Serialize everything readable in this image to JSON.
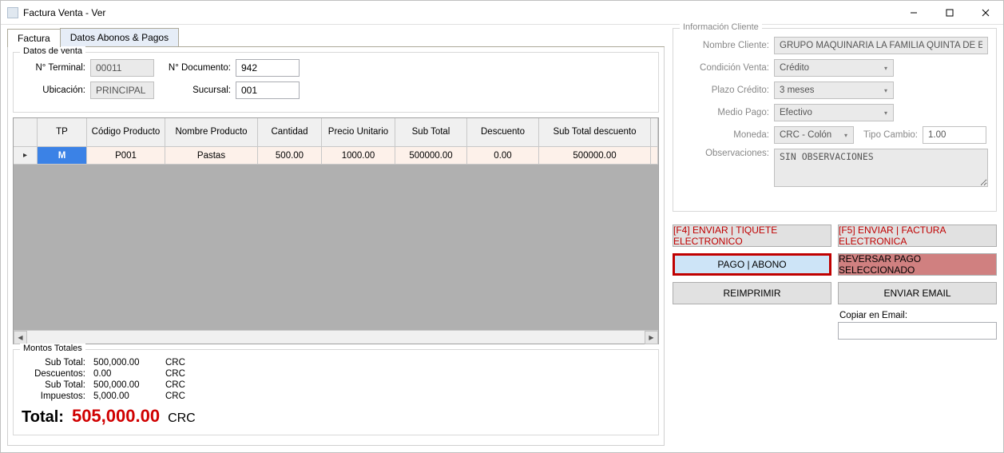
{
  "window": {
    "title": "Factura Venta - Ver"
  },
  "tabs": [
    "Factura",
    "Datos Abonos & Pagos"
  ],
  "datos_venta": {
    "legend": "Datos de venta",
    "terminal_label": "N° Terminal:",
    "terminal_value": "00011",
    "documento_label": "N° Documento:",
    "documento_value": "942",
    "ubicacion_label": "Ubicación:",
    "ubicacion_value": "PRINCIPAL",
    "sucursal_label": "Sucursal:",
    "sucursal_value": "001"
  },
  "grid": {
    "headers": {
      "tp": "TP",
      "codigo": "Código Producto",
      "nombre": "Nombre Producto",
      "cantidad": "Cantidad",
      "precio": "Precio Unitario",
      "subtotal": "Sub Total",
      "descuento": "Descuento",
      "subtotal_desc": "Sub Total descuento"
    },
    "rows": [
      {
        "tp": "M",
        "codigo": "P001",
        "nombre": "Pastas",
        "cantidad": "500.00",
        "precio": "1000.00",
        "subtotal": "500000.00",
        "descuento": "0.00",
        "subtotal_desc": "500000.00"
      }
    ]
  },
  "montos": {
    "legend": "Montos Totales",
    "subtotal_label": "Sub Total:",
    "subtotal_value": "500,000.00",
    "descuentos_label": "Descuentos:",
    "descuentos_value": "0.00",
    "subtotal2_label": "Sub Total:",
    "subtotal2_value": "500,000.00",
    "impuestos_label": "Impuestos:",
    "impuestos_value": "5,000.00",
    "currency": "CRC",
    "total_label": "Total:",
    "total_value": "505,000.00"
  },
  "client": {
    "legend": "Información Cliente",
    "nombre_label": "Nombre Cliente:",
    "nombre_value": "GRUPO MAQUINARIA LA FAMILIA QUINTA DE ESTRADA SOCI .",
    "condicion_label": "Condición Venta:",
    "condicion_value": "Crédito",
    "plazo_label": "Plazo Crédito:",
    "plazo_value": "3 meses",
    "medio_label": "Medio Pago:",
    "medio_value": "Efectivo",
    "moneda_label": "Moneda:",
    "moneda_value": "CRC - Colón",
    "tipo_cambio_label": "Tipo Cambio:",
    "tipo_cambio_value": "1.00",
    "obs_label": "Observaciones:",
    "obs_value": "SIN OBSERVACIONES"
  },
  "buttons": {
    "f4": "[F4] ENVIAR | TIQUETE ELECTRONICO",
    "f5": "[F5] ENVIAR | FACTURA ELECTRONICA",
    "pago": "PAGO | ABONO",
    "reversar": "REVERSAR PAGO SELECCIONADO",
    "reimprimir": "REIMPRIMIR",
    "email": "ENVIAR EMAIL",
    "copiar_label": "Copiar en Email:"
  }
}
